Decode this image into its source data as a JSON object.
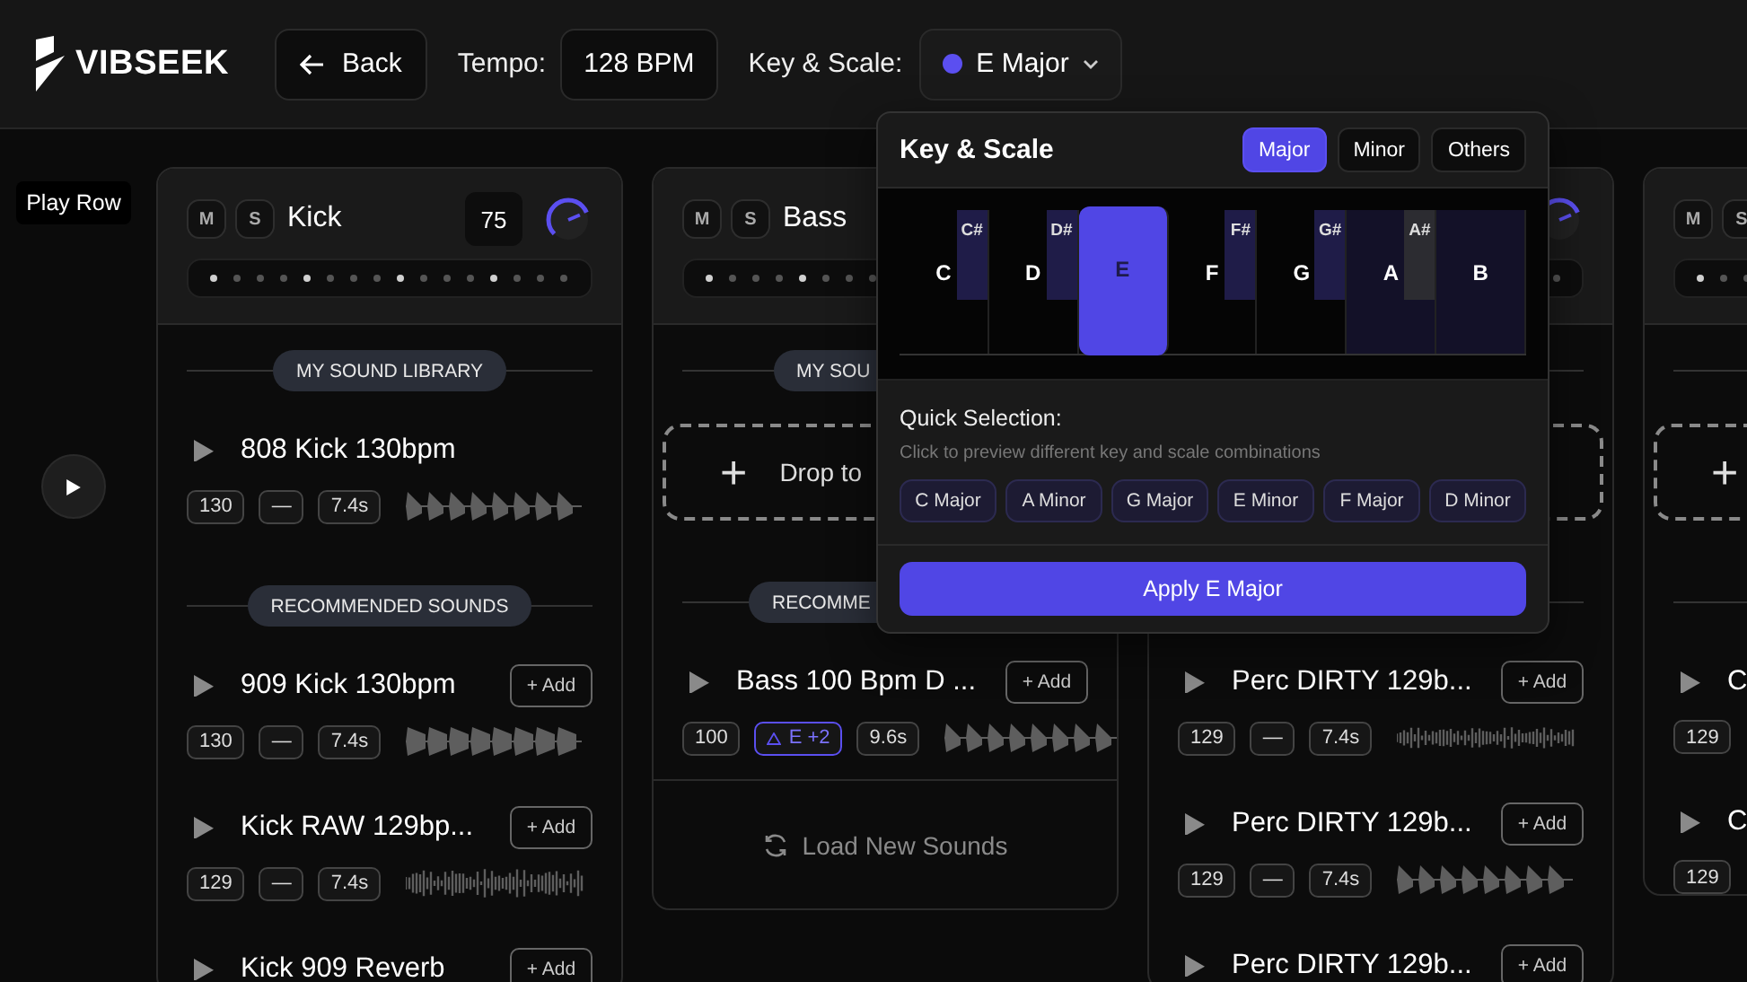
{
  "header": {
    "logo": "VIBSEEK",
    "back": "Back",
    "tempo_label": "Tempo:",
    "tempo": "128 BPM",
    "key_label": "Key & Scale:",
    "key": "E Major"
  },
  "play_row": "Play Row",
  "tracks": [
    {
      "mute": "M",
      "solo": "S",
      "name": "Kick",
      "volume": "75",
      "knob": true,
      "steps": [
        true,
        false,
        false,
        false,
        true,
        false,
        false,
        false,
        true,
        false,
        false,
        false,
        true,
        false,
        false,
        false
      ],
      "library": {
        "kind": "list",
        "label": "MY SOUND LIBRARY",
        "items": [
          {
            "title": "808 Kick 130bpm",
            "bpm": "130",
            "key": "—",
            "length": "7.4s",
            "key_warning": false
          }
        ]
      },
      "recommended": {
        "label": "RECOMMENDED SOUNDS",
        "items": [
          {
            "title": "909 Kick 130bpm",
            "add": "+ Add",
            "bpm": "130",
            "key": "—",
            "length": "7.4s",
            "key_warning": false
          },
          {
            "title": "Kick RAW 129bp...",
            "add": "+ Add",
            "bpm": "129",
            "key": "—",
            "length": "7.4s",
            "key_warning": false
          },
          {
            "title": "Kick 909 Reverb",
            "add": "+ Add"
          }
        ]
      }
    },
    {
      "mute": "M",
      "solo": "S",
      "name": "Bass",
      "steps": [
        true,
        false,
        false,
        false,
        true,
        false,
        false,
        false
      ],
      "library": {
        "kind": "dropzone",
        "label": "MY SOU",
        "drop_icon": "+",
        "drop_label": "Drop to"
      },
      "recommended": {
        "label": "RECOMME",
        "items": [
          {
            "title": "Bass 100 Bpm D ...",
            "add": "+ Add",
            "bpm": "100",
            "key": "E +2",
            "length": "9.6s",
            "key_warning": true
          }
        ]
      },
      "footer": "Load New Sounds"
    },
    {
      "knob": true,
      "steps": [
        false
      ],
      "library": {
        "kind": "dropzone"
      },
      "recommended": {
        "items": [
          {
            "title": "Perc DIRTY 129b...",
            "add": "+ Add",
            "bpm": "129",
            "key": "—",
            "length": "7.4s",
            "key_warning": false
          },
          {
            "title": "Perc DIRTY 129b...",
            "add": "+ Add",
            "bpm": "129",
            "key": "—",
            "length": "7.4s",
            "key_warning": false
          },
          {
            "title": "Perc DIRTY 129b...",
            "add": "+ Add"
          }
        ]
      }
    },
    {
      "mute": "M",
      "solo": "S",
      "steps": [
        true,
        false,
        false
      ],
      "library": {
        "kind": "dropzone",
        "drop_icon": "+"
      },
      "recommended": {
        "items": [
          {
            "title": "C",
            "bpm": "129"
          },
          {
            "title": "C",
            "bpm": "129"
          }
        ]
      }
    }
  ],
  "key_popup": {
    "title": "Key & Scale",
    "tabs": [
      {
        "label": "Major",
        "selected": true
      },
      {
        "label": "Minor",
        "selected": false
      },
      {
        "label": "Others",
        "selected": false
      }
    ],
    "white_keys": [
      {
        "note": "C",
        "in_scale": false,
        "selected": false
      },
      {
        "note": "D",
        "in_scale": false,
        "selected": false
      },
      {
        "note": "E",
        "in_scale": true,
        "selected": true
      },
      {
        "note": "F",
        "in_scale": false,
        "selected": false
      },
      {
        "note": "G",
        "in_scale": false,
        "selected": false
      },
      {
        "note": "A",
        "in_scale": true,
        "selected": false
      },
      {
        "note": "B",
        "in_scale": true,
        "selected": false
      }
    ],
    "black_keys": [
      {
        "note": "C#",
        "in_scale": true
      },
      {
        "note": "D#",
        "in_scale": true
      },
      {
        "note": "F#",
        "in_scale": true
      },
      {
        "note": "G#",
        "in_scale": true
      },
      {
        "note": "A#",
        "in_scale": false
      }
    ],
    "quick_title": "Quick Selection:",
    "quick_hint": "Click to preview different key and scale combinations",
    "presets": [
      "C Major",
      "A Minor",
      "G Major",
      "E Minor",
      "F Major",
      "D Minor"
    ],
    "apply": "Apply E Major"
  }
}
